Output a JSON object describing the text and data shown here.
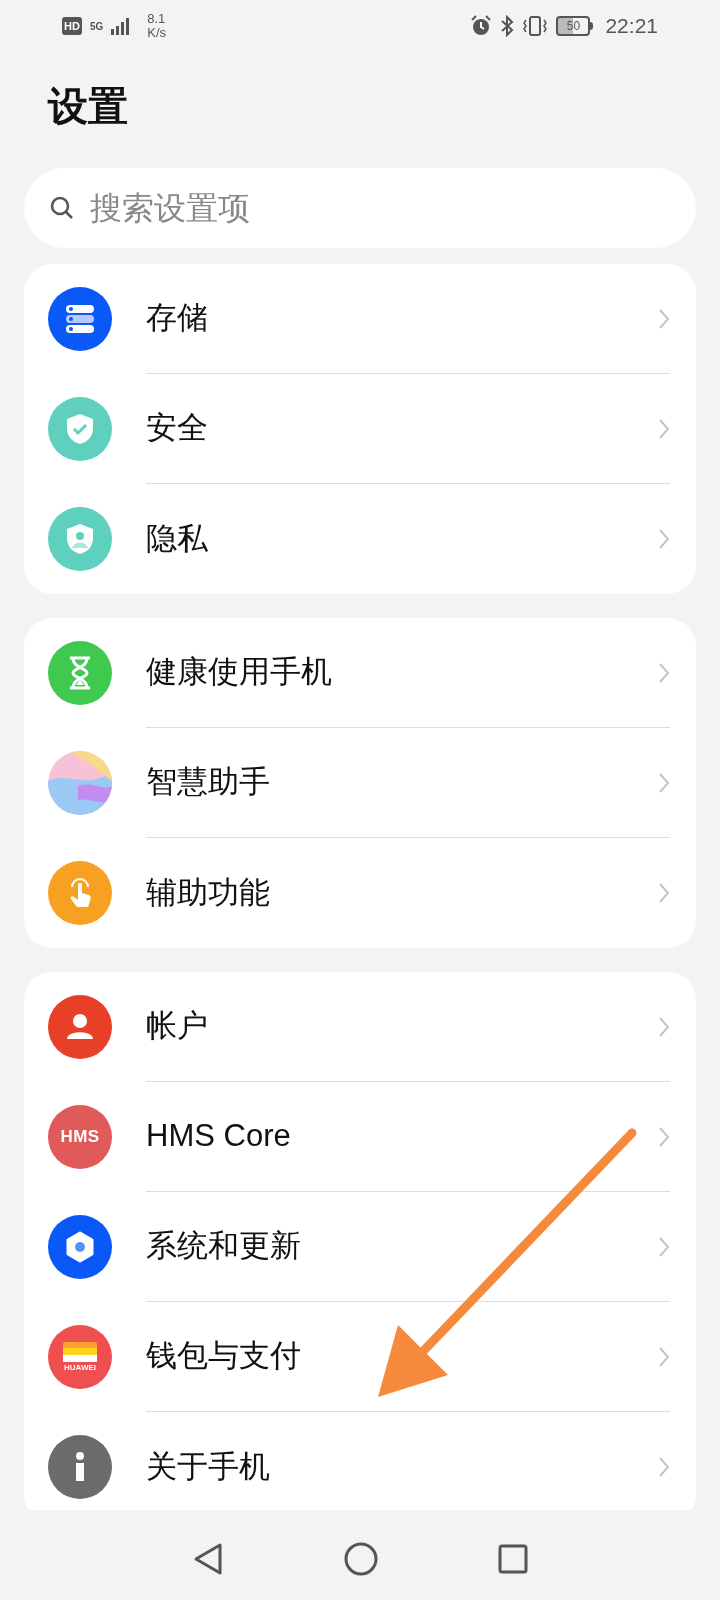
{
  "status_bar": {
    "hd": "HD",
    "network": "5G",
    "speed_value": "8.1",
    "speed_unit": "K/s",
    "battery": "50",
    "time": "22:21"
  },
  "title": "设置",
  "search": {
    "placeholder": "搜索设置项"
  },
  "groups": [
    {
      "items": [
        {
          "label": "存储"
        },
        {
          "label": "安全"
        },
        {
          "label": "隐私"
        }
      ]
    },
    {
      "items": [
        {
          "label": "健康使用手机"
        },
        {
          "label": "智慧助手"
        },
        {
          "label": "辅助功能"
        }
      ]
    },
    {
      "items": [
        {
          "label": "帐户"
        },
        {
          "label": "HMS Core",
          "icon_text": "HMS"
        },
        {
          "label": "系统和更新"
        },
        {
          "label": "钱包与支付",
          "icon_text": "HUAWEI"
        },
        {
          "label": "关于手机"
        }
      ]
    }
  ]
}
